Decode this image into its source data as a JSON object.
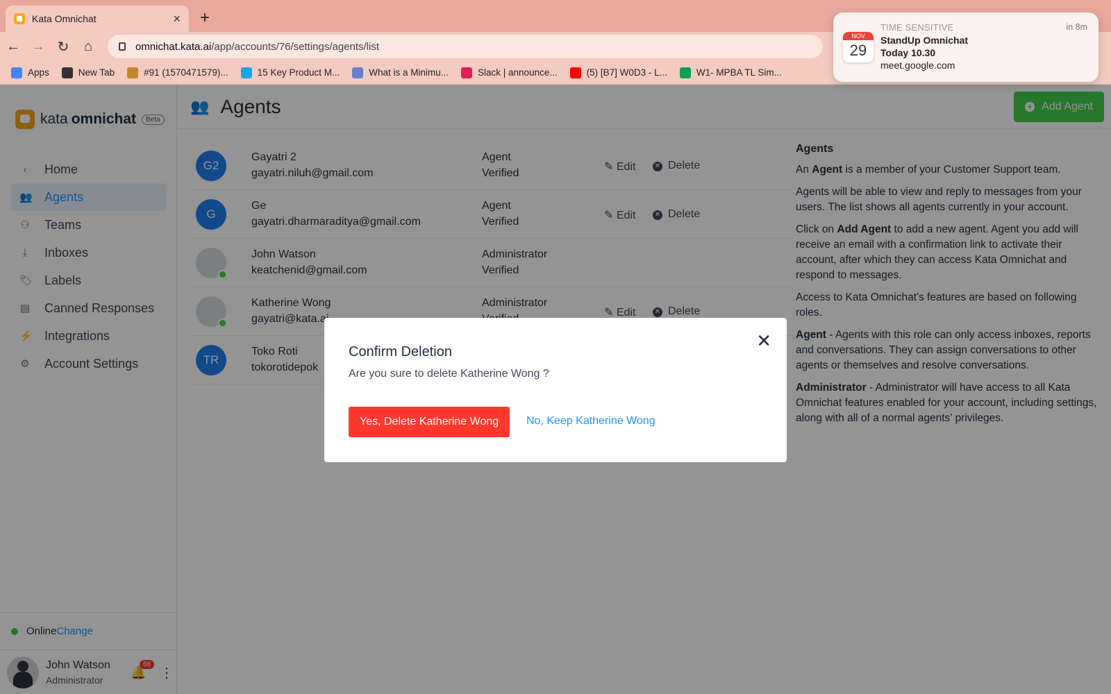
{
  "browser": {
    "tab_title": "Kata Omnichat",
    "tab_close": "×",
    "new_tab": "+",
    "url_host": "omnichat.kata.ai",
    "url_path": "/app/accounts/76/settings/agents/list",
    "bookmarks": [
      {
        "label": "Apps",
        "icon": "apps-grid-icon",
        "color": "#4285f4"
      },
      {
        "label": "New Tab",
        "icon": "new-tab-icon",
        "color": "#333333"
      },
      {
        "label": "#91 (1570471579)...",
        "icon": "bookmark-icon",
        "color": "#c4862a"
      },
      {
        "label": "15 Key Product M...",
        "icon": "bookmark-icon",
        "color": "#1aa3e8"
      },
      {
        "label": "What is a Minimu...",
        "icon": "bookmark-icon",
        "color": "#6a7fc9"
      },
      {
        "label": "Slack | announce...",
        "icon": "slack-icon",
        "color": "#e01e5a"
      },
      {
        "label": "(5) [B7] W0D3 - L...",
        "icon": "youtube-icon",
        "color": "#ff0000"
      },
      {
        "label": "W1- MPBA TL Sim...",
        "icon": "sheets-icon",
        "color": "#0f9d58"
      }
    ]
  },
  "notification": {
    "cal_month": "NOV",
    "cal_day": "29",
    "label": "TIME SENSITIVE",
    "when": "in 8m",
    "title": "StandUp Omnichat",
    "time": "Today 10.30",
    "source": "meet.google.com"
  },
  "sidebar": {
    "logo_a": "kata",
    "logo_b": "omnichat",
    "beta": "Beta",
    "items": [
      {
        "label": "Home",
        "icon": "chevron-left-icon",
        "glyph": "‹"
      },
      {
        "label": "Agents",
        "icon": "agents-icon",
        "glyph": "👥"
      },
      {
        "label": "Teams",
        "icon": "teams-icon",
        "glyph": "⚇"
      },
      {
        "label": "Inboxes",
        "icon": "inbox-icon",
        "glyph": "⤓"
      },
      {
        "label": "Labels",
        "icon": "tag-icon",
        "glyph": "🏷"
      },
      {
        "label": "Canned Responses",
        "icon": "chat-icon",
        "glyph": "▤"
      },
      {
        "label": "Integrations",
        "icon": "bolt-icon",
        "glyph": "⚡"
      },
      {
        "label": "Account Settings",
        "icon": "gear-icon",
        "glyph": "⚙"
      }
    ],
    "status": "Online",
    "change": "Change",
    "user_name": "John Watson",
    "user_role": "Administrator",
    "notif_count": "66"
  },
  "header": {
    "title": "Agents",
    "add_label": "Add Agent"
  },
  "agents": [
    {
      "initials": "G2",
      "name": "Gayatri 2",
      "email": "gayatri.niluh@gmail.com",
      "role": "Agent",
      "status": "Verified",
      "edit": "Edit",
      "delete": "Delete"
    },
    {
      "initials": "G",
      "name": "Ge",
      "email": "gayatri.dharmaraditya@gmail.com",
      "role": "Agent",
      "status": "Verified",
      "edit": "Edit",
      "delete": "Delete"
    },
    {
      "initials": "",
      "name": "John Watson",
      "email": "keatchenid@gmail.com",
      "role": "Administrator",
      "status": "Verified"
    },
    {
      "initials": "",
      "name": "Katherine Wong",
      "email": "gayatri@kata.ai",
      "role": "Administrator",
      "status": "Verified",
      "edit": "Edit",
      "delete": "Delete"
    },
    {
      "initials": "TR",
      "name": "Toko Roti",
      "email": "tokorotidepok"
    }
  ],
  "help": {
    "title": "Agents",
    "p1a": "An ",
    "p1b": "Agent",
    "p1c": " is a member of your Customer Support team.",
    "p2": "Agents will be able to view and reply to messages from your users. The list shows all agents currently in your account.",
    "p3a": "Click on ",
    "p3b": "Add Agent",
    "p3c": " to add a new agent. Agent you add will receive an email with a confirmation link to activate their account, after which they can access Kata Omnichat and respond to messages.",
    "p4": "Access to Kata Omnichat's features are based on following roles.",
    "p5a": "Agent",
    "p5b": " - Agents with this role can only access inboxes, reports and conversations. They can assign conversations to other agents or themselves and resolve conversations.",
    "p6a": "Administrator",
    "p6b": " - Administrator will have access to all Kata Omnichat features enabled for your account, including settings, along with all of a normal agents' privileges."
  },
  "modal": {
    "title": "Confirm Deletion",
    "body": "Are you sure to delete Katherine Wong ?",
    "confirm": "Yes, Delete Katherine Wong",
    "cancel": "No, Keep Katherine Wong"
  },
  "colors": {
    "accent": "#1f93ff",
    "success": "#44ce4b",
    "danger": "#ff382d",
    "browser_frame": "#e8a99a"
  }
}
